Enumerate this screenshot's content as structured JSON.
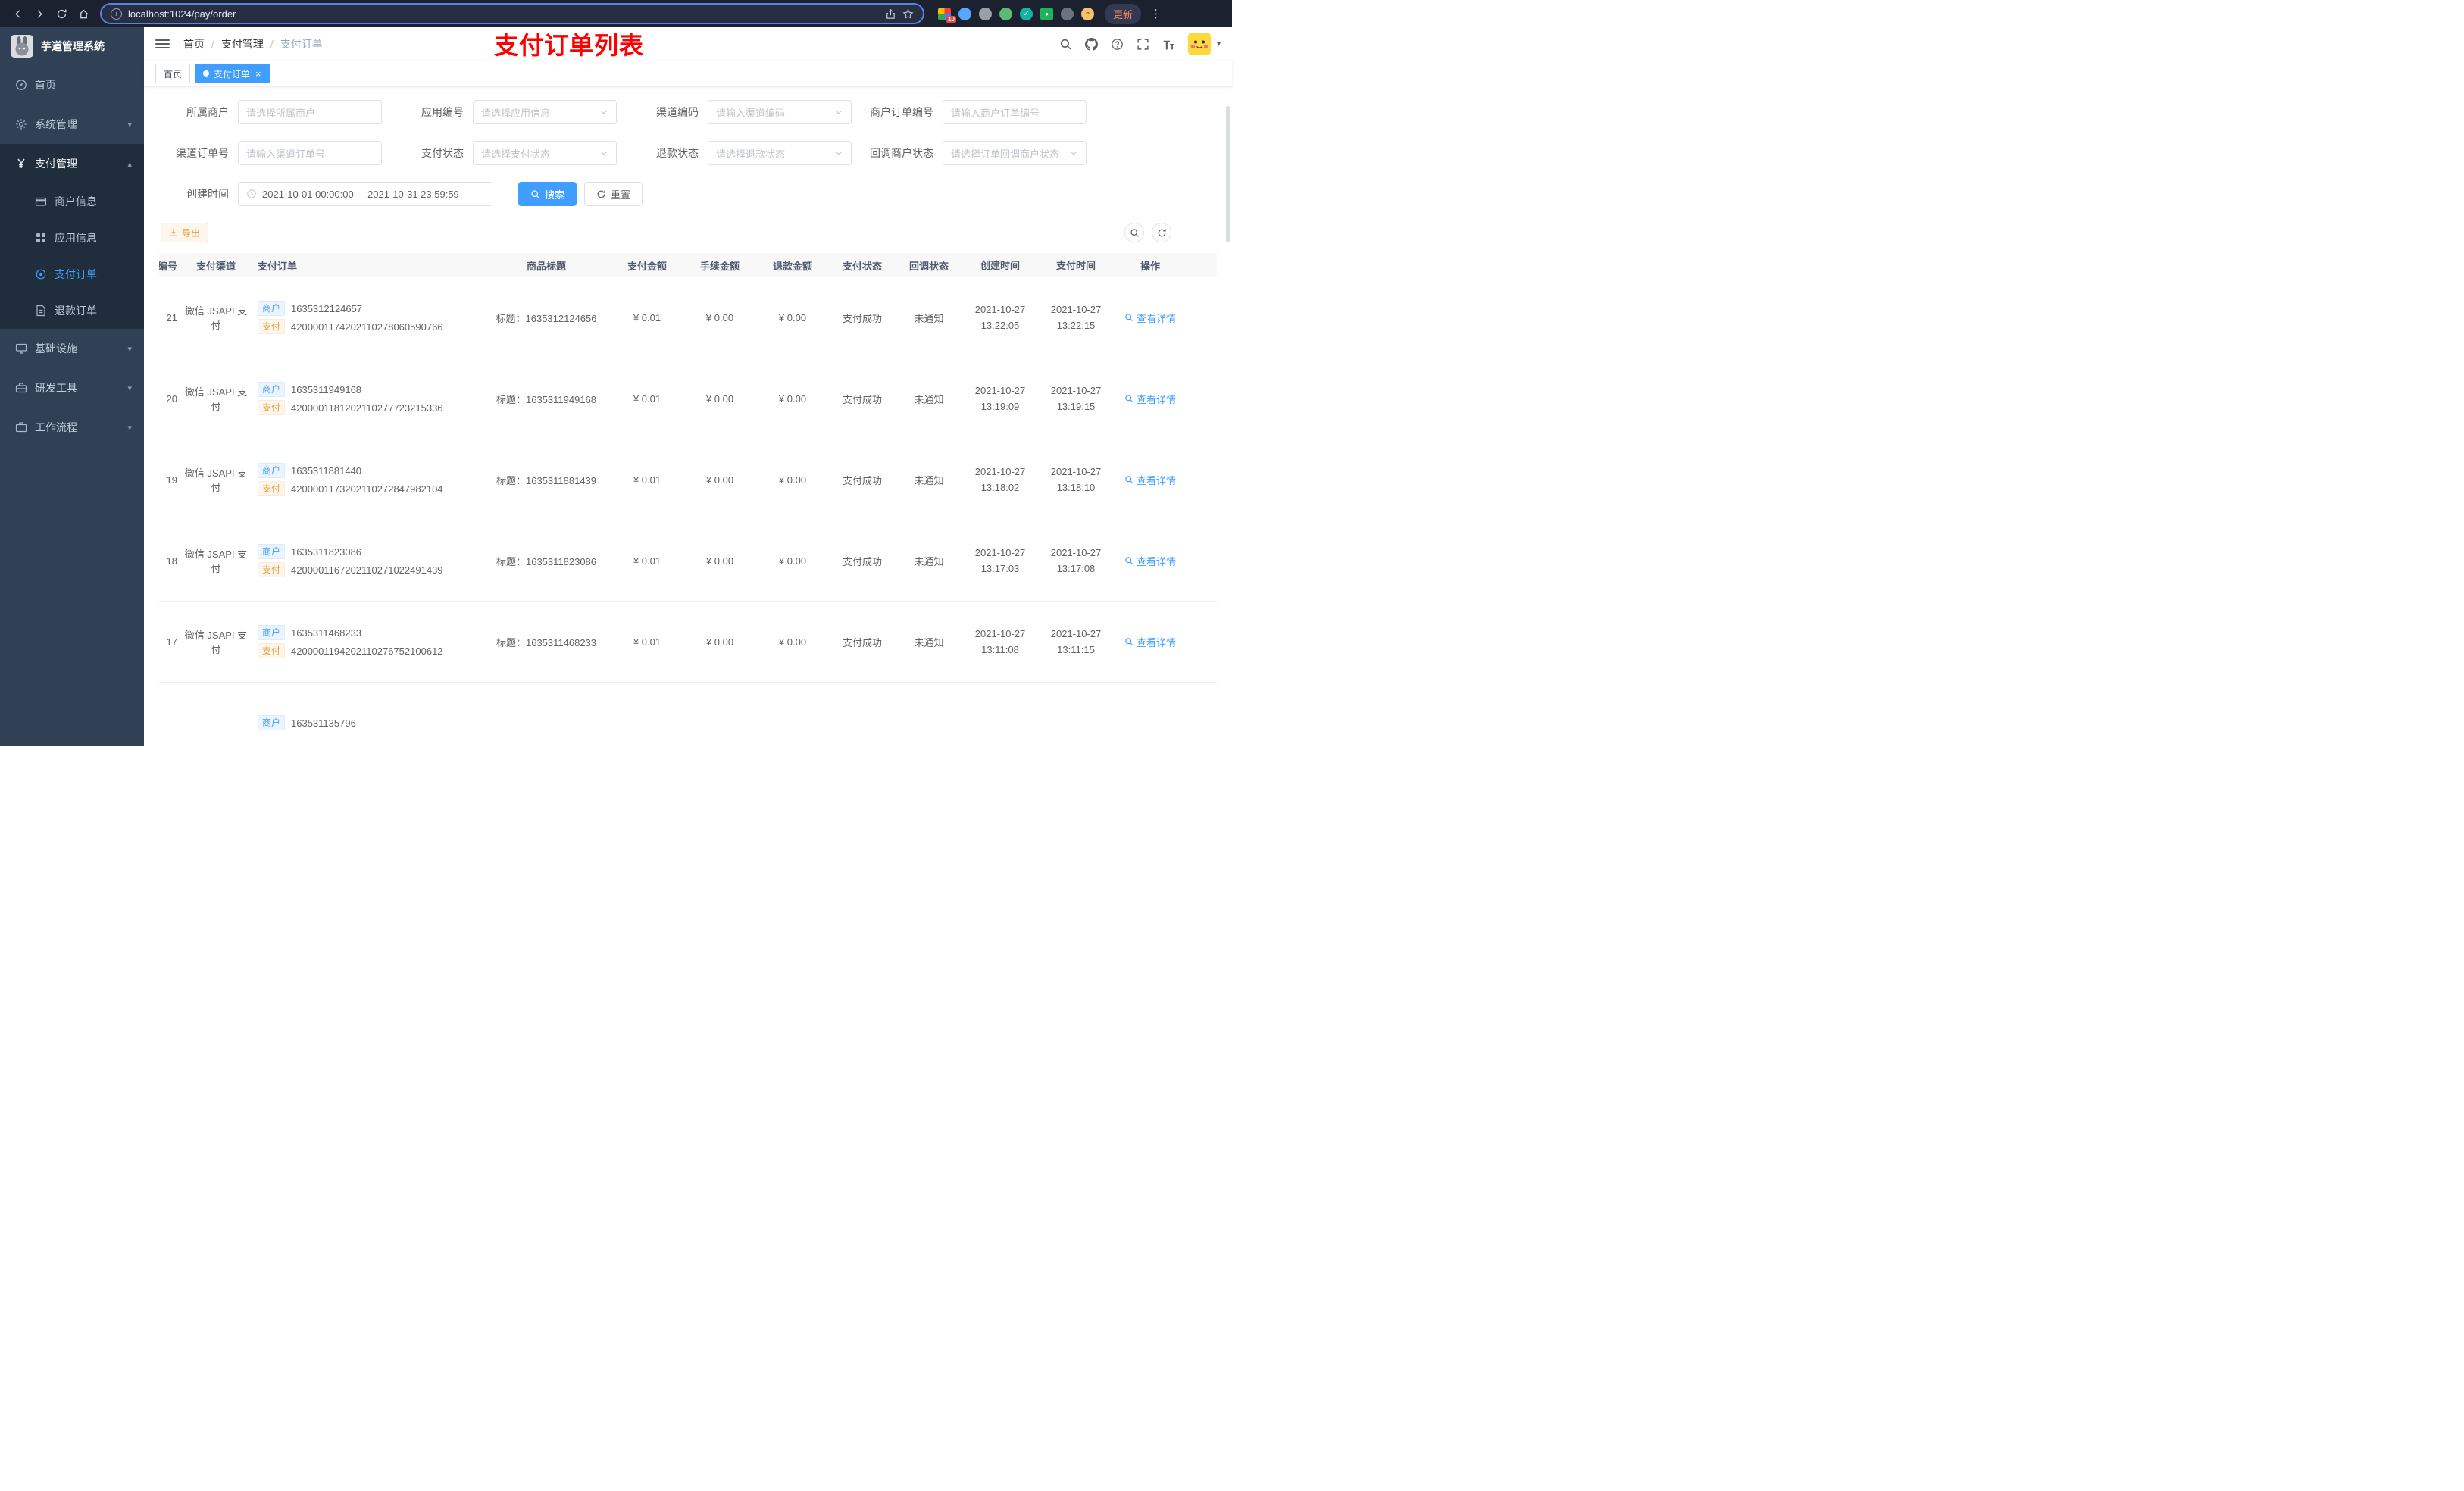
{
  "browser": {
    "url": "localhost:1024/pay/order",
    "update_label": "更新",
    "extension_badge": "10"
  },
  "sidebar": {
    "title": "芋道管理系统",
    "menu": [
      {
        "key": "home",
        "label": "首页",
        "icon": "dashboard-icon",
        "type": "item"
      },
      {
        "key": "system",
        "label": "系统管理",
        "icon": "gear-icon",
        "type": "group",
        "chevron": "down"
      },
      {
        "key": "payment",
        "label": "支付管理",
        "icon": "yen-icon",
        "type": "group",
        "chevron": "up",
        "expanded": true
      },
      {
        "key": "merchant-info",
        "label": "商户信息",
        "icon": "merchant-card-icon",
        "type": "subitem"
      },
      {
        "key": "app-info",
        "label": "应用信息",
        "icon": "app-grid-icon",
        "type": "subitem"
      },
      {
        "key": "pay-order",
        "label": "支付订单",
        "icon": "pay-order-icon",
        "type": "subitem",
        "active": true
      },
      {
        "key": "refund-order",
        "label": "退款订单",
        "icon": "refund-doc-icon",
        "type": "subitem"
      },
      {
        "key": "infrastructure",
        "label": "基础设施",
        "icon": "infra-icon",
        "type": "group",
        "chevron": "down"
      },
      {
        "key": "dev-tools",
        "label": "研发工具",
        "icon": "devtool-icon",
        "type": "group",
        "chevron": "down"
      },
      {
        "key": "workflow",
        "label": "工作流程",
        "icon": "workflow-icon",
        "type": "group",
        "chevron": "down"
      }
    ]
  },
  "header": {
    "breadcrumb": [
      "首页",
      "支付管理",
      "支付订单"
    ],
    "separator": "/",
    "annotation": "支付订单列表"
  },
  "tabs": [
    {
      "key": "home",
      "label": "首页",
      "active": false,
      "closable": false
    },
    {
      "key": "pay-order",
      "label": "支付订单",
      "active": true,
      "closable": true
    }
  ],
  "filters": {
    "rows": [
      [
        {
          "key": "owner-merchant",
          "label": "所属商户",
          "placeholder": "请选择所属商户",
          "type": "input"
        },
        {
          "key": "app-no",
          "label": "应用编号",
          "placeholder": "请选择应用信息",
          "type": "select"
        },
        {
          "key": "channel-code",
          "label": "渠道编码",
          "placeholder": "请输入渠道编码",
          "type": "select"
        },
        {
          "key": "merchant-order-no",
          "label": "商户订单编号",
          "placeholder": "请输入商户订单编号",
          "type": "input"
        }
      ],
      [
        {
          "key": "channel-order-no",
          "label": "渠道订单号",
          "placeholder": "请输入渠道订单号",
          "type": "input"
        },
        {
          "key": "pay-status",
          "label": "支付状态",
          "placeholder": "请选择支付状态",
          "type": "select"
        },
        {
          "key": "refund-status",
          "label": "退款状态",
          "placeholder": "请选择退款状态",
          "type": "select"
        },
        {
          "key": "callback-status",
          "label": "回调商户状态",
          "placeholder": "请选择订单回调商户状态",
          "type": "select"
        }
      ]
    ],
    "date": {
      "label": "创建时间",
      "start": "2021-10-01 00:00:00",
      "separator": "-",
      "end": "2021-10-31 23:59:59"
    },
    "search_label": "搜索",
    "reset_label": "重置",
    "export_label": "导出"
  },
  "table": {
    "columns": [
      "编号",
      "支付渠道",
      "支付订单",
      "商品标题",
      "支付金额",
      "手续金额",
      "退款金额",
      "支付状态",
      "回调状态",
      "创建时间",
      "支付时间",
      "操作"
    ],
    "tag_merchant": "商户",
    "tag_pay": "支付",
    "action_label": "查看详情",
    "rows": [
      {
        "id": "21",
        "channel": "微信 JSAPI 支付",
        "merchant_no": "1635312124657",
        "pay_no": "4200001174202110278060590766",
        "title": "标题：1635312124656",
        "amount": "¥ 0.01",
        "fee": "¥ 0.00",
        "refund": "¥ 0.00",
        "status": "支付成功",
        "notify": "未通知",
        "create_time": "2021-10-27 13:22:05",
        "pay_time": "2021-10-27 13:22:15",
        "partial": false
      },
      {
        "id": "20",
        "channel": "微信 JSAPI 支付",
        "merchant_no": "1635311949168",
        "pay_no": "4200001181202110277723215336",
        "title": "标题：1635311949168",
        "amount": "¥ 0.01",
        "fee": "¥ 0.00",
        "refund": "¥ 0.00",
        "status": "支付成功",
        "notify": "未通知",
        "create_time": "2021-10-27 13:19:09",
        "pay_time": "2021-10-27 13:19:15",
        "partial": false
      },
      {
        "id": "19",
        "channel": "微信 JSAPI 支付",
        "merchant_no": "1635311881440",
        "pay_no": "4200001173202110272847982104",
        "title": "标题：1635311881439",
        "amount": "¥ 0.01",
        "fee": "¥ 0.00",
        "refund": "¥ 0.00",
        "status": "支付成功",
        "notify": "未通知",
        "create_time": "2021-10-27 13:18:02",
        "pay_time": "2021-10-27 13:18:10",
        "partial": false
      },
      {
        "id": "18",
        "channel": "微信 JSAPI 支付",
        "merchant_no": "1635311823086",
        "pay_no": "4200001167202110271022491439",
        "title": "标题：1635311823086",
        "amount": "¥ 0.01",
        "fee": "¥ 0.00",
        "refund": "¥ 0.00",
        "status": "支付成功",
        "notify": "未通知",
        "create_time": "2021-10-27 13:17:03",
        "pay_time": "2021-10-27 13:17:08",
        "partial": false
      },
      {
        "id": "17",
        "channel": "微信 JSAPI 支付",
        "merchant_no": "1635311468233",
        "pay_no": "4200001194202110276752100612",
        "title": "标题：1635311468233",
        "amount": "¥ 0.01",
        "fee": "¥ 0.00",
        "refund": "¥ 0.00",
        "status": "支付成功",
        "notify": "未通知",
        "create_time": "2021-10-27 13:11:08",
        "pay_time": "2021-10-27 13:11:15",
        "partial": false
      },
      {
        "id": "",
        "channel": "",
        "merchant_no": "163531135796",
        "pay_no": "",
        "title": "",
        "amount": "",
        "fee": "",
        "refund": "",
        "status": "",
        "notify": "",
        "create_time": "",
        "pay_time": "",
        "partial": true
      }
    ]
  }
}
